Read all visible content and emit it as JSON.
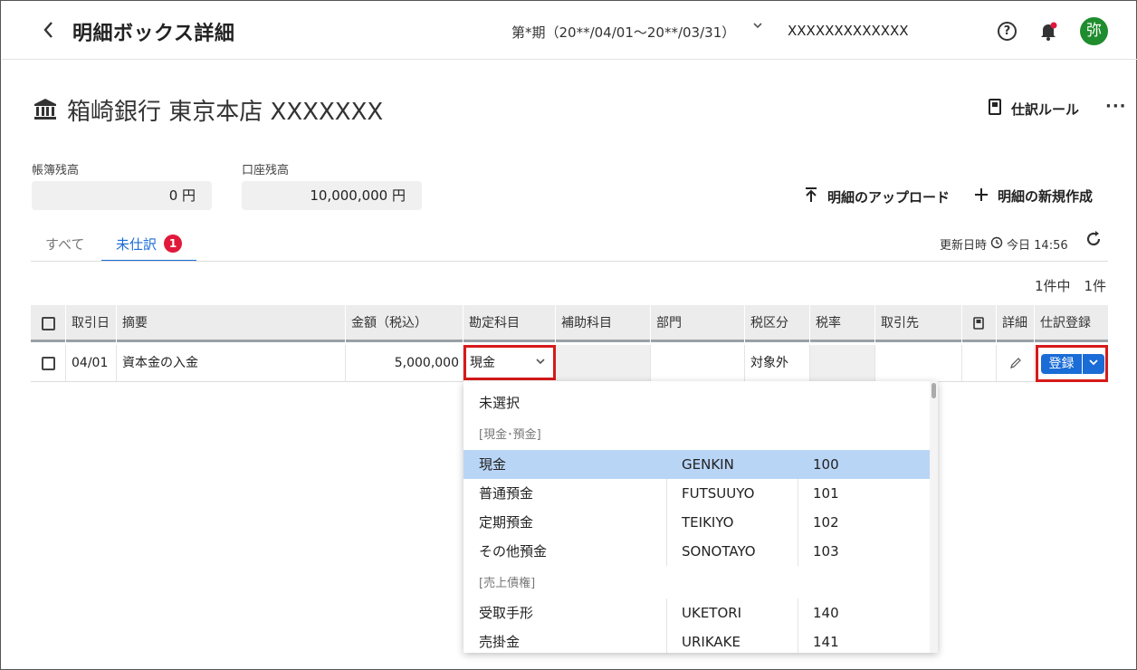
{
  "header": {
    "back_icon": "chevron-left-icon",
    "title": "明細ボックス詳細",
    "period": "第*期（20**/04/01〜20**/03/31）",
    "company": "XXXXXXXXXXXXX",
    "avatar_label": "弥",
    "avatar_color": "#1f8c2e"
  },
  "account": {
    "title": "箱崎銀行 東京本店 XXXXXXX",
    "rule_label": "仕訳ルール",
    "more_label": "···"
  },
  "balances": {
    "book_label": "帳簿残高",
    "book_value": "0 円",
    "bank_label": "口座残高",
    "bank_value": "10,000,000 円"
  },
  "actions": {
    "upload_label": "明細のアップロード",
    "new_label": "明細の新規作成"
  },
  "tabs": {
    "all": "すべて",
    "unjournal": "未仕訳",
    "unjournal_badge": "1"
  },
  "updated": {
    "label": "更新日時",
    "value": "今日 14:56"
  },
  "count": "1件中　1件",
  "table": {
    "headers": [
      "取引日",
      "摘要",
      "金額（税込）",
      "勘定科目",
      "補助科目",
      "部門",
      "税区分",
      "税率",
      "取引先",
      "詳細",
      "仕訳登録"
    ],
    "row": {
      "date": "04/01",
      "description": "資本金の入金",
      "amount": "5,000,000",
      "account": "現金",
      "tax_category": "対象外",
      "register_label": "登録"
    }
  },
  "dropdown": {
    "unselected": "未選択",
    "group_cash": "[現金･預金]",
    "group_receivables": "[売上債権]",
    "items_cash": [
      {
        "name": "現金",
        "code": "GENKIN",
        "num": "100"
      },
      {
        "name": "普通預金",
        "code": "FUTSUUYO",
        "num": "101"
      },
      {
        "name": "定期預金",
        "code": "TEIKIYO",
        "num": "102"
      },
      {
        "name": "その他預金",
        "code": "SONOTAYO",
        "num": "103"
      }
    ],
    "items_recv": [
      {
        "name": "受取手形",
        "code": "UKETORI",
        "num": "140"
      },
      {
        "name": "売掛金",
        "code": "URIKAKE",
        "num": "141"
      }
    ]
  },
  "colors": {
    "accent": "#1a6cd6",
    "highlight_border": "#d71a1a",
    "selected_row": "#b9d5f6",
    "badge": "#e0193b"
  }
}
